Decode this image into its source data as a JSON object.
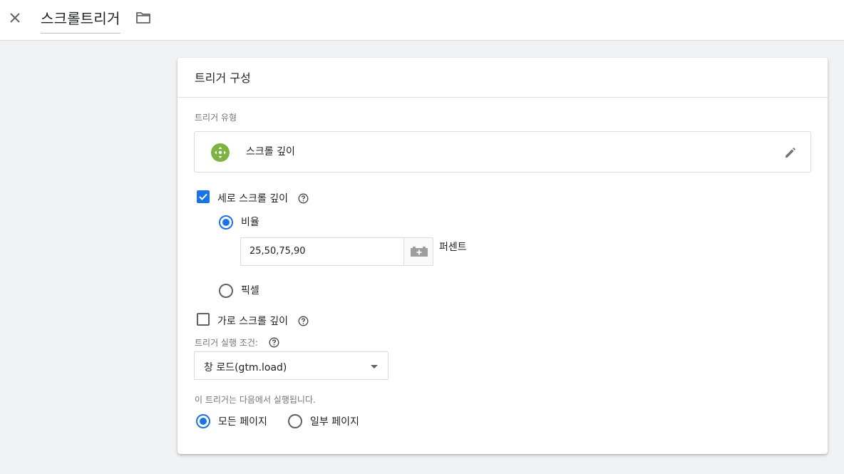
{
  "header": {
    "title": "스크롤트리거"
  },
  "card": {
    "title": "트리거 구성",
    "trigger_type_label": "트리거 유형",
    "trigger_type_name": "스크롤 깊이",
    "vertical": {
      "label": "세로 스크롤 깊이",
      "checked": true
    },
    "ratio": {
      "label": "비율",
      "selected": true
    },
    "percentages_value": "25,50,75,90",
    "percent_unit": "퍼센트",
    "pixels": {
      "label": "픽셀",
      "selected": false
    },
    "horizontal": {
      "label": "가로 스크롤 깊이",
      "checked": false
    },
    "fire_on_label": "트리거 실행 조건:",
    "fire_on_value": "창 로드(gtm.load)",
    "runs_on_label": "이 트리거는 다음에서 실행됩니다.",
    "all_pages": {
      "label": "모든 페이지",
      "selected": true
    },
    "some_pages": {
      "label": "일부 페이지",
      "selected": false
    }
  },
  "colors": {
    "accent": "#1a73e8",
    "trigger_icon": "#7cb342"
  },
  "icons": [
    "close-icon",
    "folder-icon",
    "scroll-move-icon",
    "pencil-icon",
    "help-icon",
    "add-variable-icon",
    "dropdown-arrow-icon"
  ]
}
